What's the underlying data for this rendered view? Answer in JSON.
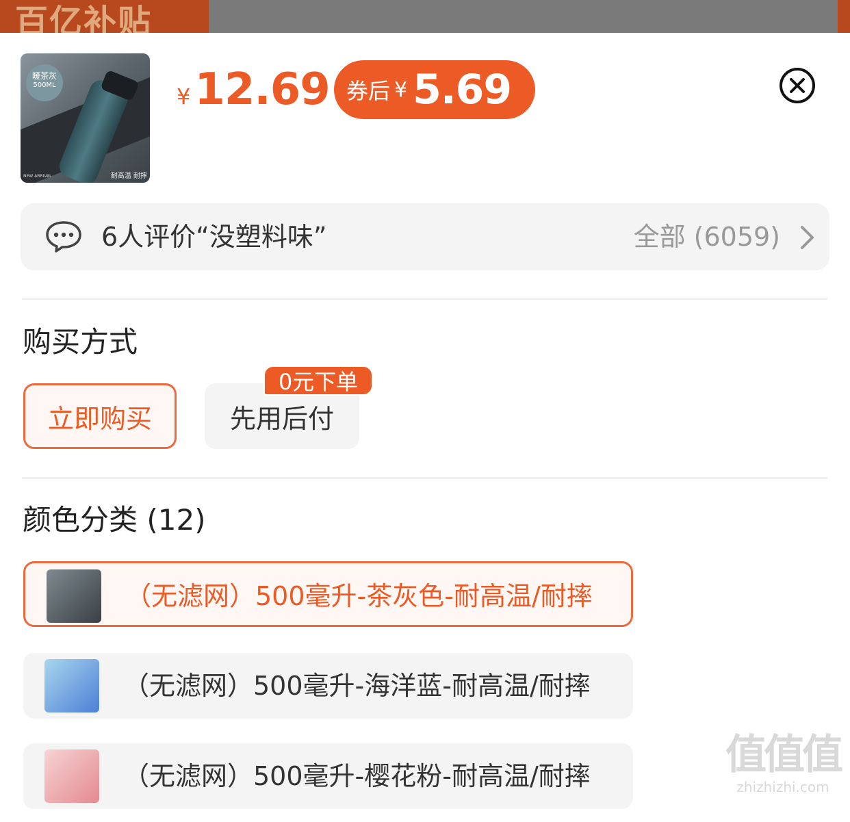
{
  "banner": {
    "promo_text": "百亿补贴"
  },
  "product": {
    "thumbnail": {
      "badge_color": "暖茶灰",
      "badge_volume": "500ML",
      "corner_left": "NEW ARRIVAL",
      "corner_right": "耐高温 耐摔"
    },
    "price": {
      "currency": "¥",
      "value": "12.69"
    },
    "coupon": {
      "label": "券后",
      "currency": "¥",
      "value": "5.69"
    }
  },
  "review": {
    "summary": "6人评价“没塑料味”",
    "all_label": "全部 (6059)"
  },
  "purchase": {
    "title": "购买方式",
    "options": [
      {
        "label": "立即购买",
        "selected": true
      },
      {
        "label": "先用后付",
        "selected": false,
        "tag": "0元下单"
      }
    ]
  },
  "colors": {
    "title": "颜色分类 (12)",
    "options": [
      {
        "label": "（无滤网）500毫升-茶灰色-耐高温/耐摔",
        "selected": true
      },
      {
        "label": "（无滤网）500毫升-海洋蓝-耐高温/耐摔",
        "selected": false
      },
      {
        "label": "（无滤网）500毫升-樱花粉-耐高温/耐摔",
        "selected": false
      }
    ]
  },
  "watermark": {
    "logo": "值值值",
    "domain": "zhizhizhi.com"
  },
  "theme": {
    "accent": "#ec5b25",
    "gray_bg": "#f4f4f4"
  }
}
